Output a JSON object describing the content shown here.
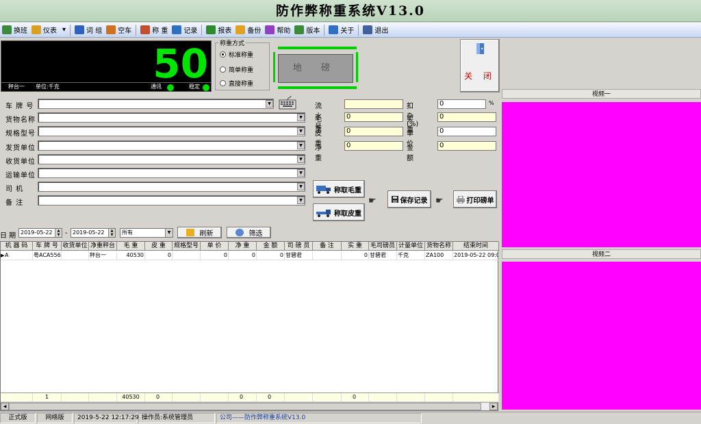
{
  "window": {
    "title": "防作弊称重系统V13.0"
  },
  "toolbar": [
    {
      "label": "换班",
      "icon": "switch-shift-icon",
      "color": "#3b8a3b"
    },
    {
      "label": "仪表",
      "icon": "meter-icon",
      "color": "#d8a020"
    },
    {
      "label": "词 组",
      "icon": "pen-icon",
      "color": "#3060c0"
    },
    {
      "label": "空车",
      "icon": "truck-icon",
      "color": "#d07020"
    },
    {
      "label": "称 重",
      "icon": "scale-icon",
      "color": "#c05030"
    },
    {
      "label": "记录",
      "icon": "table-icon",
      "color": "#3070c0"
    },
    {
      "label": "报表",
      "icon": "report-icon",
      "color": "#2f8a2f"
    },
    {
      "label": "备份",
      "icon": "backup-icon",
      "color": "#e0a020"
    },
    {
      "label": "帮助",
      "icon": "help-icon",
      "color": "#9040c0"
    },
    {
      "label": "版本",
      "icon": "version-icon",
      "color": "#3a8a3a"
    },
    {
      "label": "关于",
      "icon": "about-icon",
      "color": "#3070c0"
    },
    {
      "label": "退出",
      "icon": "exit-icon",
      "color": "#4060a0"
    }
  ],
  "scale": {
    "weight": "50",
    "station": "秤台一",
    "unit": "单位:千克",
    "comm": "通讯",
    "stable": "稳定"
  },
  "weigh_mode": {
    "legend": "称重方式",
    "options": [
      "标准称重",
      "简单称重",
      "直接称重"
    ],
    "selected": 0
  },
  "floor_label": "地 磅",
  "close_button": "关 闭",
  "form": {
    "plate": "车 牌 号",
    "goods": "货物名称",
    "spec": "规格型号",
    "sender": "发货单位",
    "receiver": "收货单位",
    "transport": "运输单位",
    "driver": "司  机",
    "remark": "备  注"
  },
  "numbers": {
    "serial_label": "流 水 号",
    "serial": "",
    "deduct_label": "扣 杂(%)",
    "deduct": "0",
    "pct": "%",
    "gross_label": "毛  重",
    "gross": "0",
    "net_actual_label": "实  重",
    "net_actual": "0",
    "tare_label": "皮  重",
    "tare": "0",
    "price_label": "单  价",
    "price": "0",
    "net_label": "净  重",
    "net": "0",
    "amount_label": "金  额",
    "amount": "0"
  },
  "buttons": {
    "gross": "称取毛重",
    "tare": "称取皮重",
    "save": "保存记录",
    "print": "打印磅单"
  },
  "filter": {
    "date_label": "日 期",
    "date_from": "2019-05-22",
    "date_to": "2019-05-22",
    "dash": "-",
    "scope": "所有",
    "refresh": "刷新",
    "filter": "筛选"
  },
  "grid": {
    "columns": [
      {
        "label": "机 器 码",
        "w": 47
      },
      {
        "label": "车 牌 号",
        "w": 42
      },
      {
        "label": "收货单位",
        "w": 40
      },
      {
        "label": "净重秤台",
        "w": 41
      },
      {
        "label": "毛   重",
        "w": 41
      },
      {
        "label": "皮   重",
        "w": 40
      },
      {
        "label": "规格型号",
        "w": 41
      },
      {
        "label": "单   价",
        "w": 41
      },
      {
        "label": "净   重",
        "w": 41
      },
      {
        "label": "金   额",
        "w": 41
      },
      {
        "label": "司 磅 员",
        "w": 41
      },
      {
        "label": "备   注",
        "w": 42
      },
      {
        "label": "实   重",
        "w": 40
      },
      {
        "label": "毛司磅员",
        "w": 41
      },
      {
        "label": "计量单位",
        "w": 41
      },
      {
        "label": "货物名称",
        "w": 41
      },
      {
        "label": "结束时间",
        "w": 67
      }
    ],
    "rows": [
      [
        "A",
        "粤ACA556",
        "",
        "秤台一",
        "40530",
        "0",
        "",
        "0",
        "0",
        "0",
        "甘碧君",
        "",
        "0",
        "甘碧君",
        "千克",
        "ZA100",
        "2019-05-22 09:0"
      ]
    ],
    "footer": [
      "",
      "1",
      "",
      "",
      "40530",
      "0",
      "",
      "",
      "0",
      "0",
      "",
      "",
      "0",
      "",
      "",
      "",
      ""
    ]
  },
  "video": {
    "cam1": "视频一",
    "cam2": "视频二"
  },
  "status": {
    "edition": "正式版",
    "network": "网络版",
    "datetime": "2019-5-22 12:17:29",
    "operator": "操作员:系统管理员",
    "marquee": "公司——防作弊称重系统V13.0"
  }
}
